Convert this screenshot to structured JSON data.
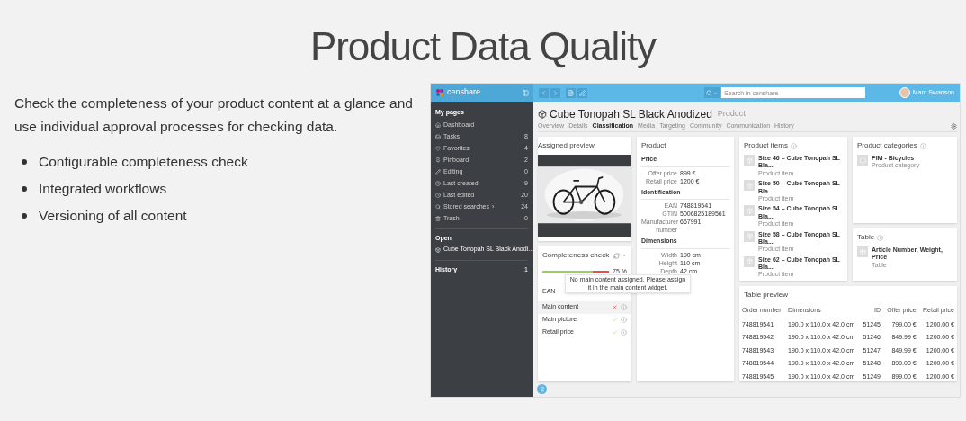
{
  "page": {
    "title": "Product Data Quality",
    "intro": "Check the completeness of your product content at a glance and use individual approval processes for checking data.",
    "bullets": [
      "Configurable completeness check",
      "Integrated workflows",
      "Versioning of all content"
    ]
  },
  "app": {
    "logo": "censhare",
    "search": {
      "placeholder": "Search in censhare"
    },
    "user": "Marc Swanson",
    "sidebar": {
      "heading": "My pages",
      "items": [
        {
          "label": "Dashboard"
        },
        {
          "label": "Tasks",
          "count": "8"
        },
        {
          "label": "Favorites",
          "count": "4"
        },
        {
          "label": "Pinboard",
          "count": "2"
        },
        {
          "label": "Editing",
          "count": "0"
        },
        {
          "label": "Last created",
          "count": "9"
        },
        {
          "label": "Last edited",
          "count": "20"
        },
        {
          "label": "Stored searches",
          "arrow": "›",
          "count": "24"
        },
        {
          "label": "Trash",
          "count": "0"
        }
      ],
      "open_heading": "Open",
      "open_items": [
        {
          "label": "Cube Tonopah SL Black Anodi...",
          "selected": true
        }
      ],
      "history": {
        "label": "History",
        "count": "1"
      }
    },
    "asset": {
      "title": "Cube Tonopah SL Black Anodized",
      "type": "Product",
      "tabs": [
        {
          "label": "Overview",
          "selected": false
        },
        {
          "label": "Details",
          "selected": false
        },
        {
          "label": "Classification",
          "selected": true
        },
        {
          "label": "Media",
          "selected": false
        },
        {
          "label": "Targeting",
          "selected": false
        },
        {
          "label": "Community",
          "selected": false
        },
        {
          "label": "Communication",
          "selected": false
        },
        {
          "label": "History",
          "selected": false
        }
      ]
    },
    "assigned_preview": {
      "title": "Assigned preview"
    },
    "completeness": {
      "title": "Completeness check",
      "level": 0.75,
      "reading": "75 %",
      "column": "EAN",
      "rows": [
        {
          "label": "Main content",
          "ok": false,
          "selected": true
        },
        {
          "label": "Main picture",
          "ok": true,
          "selected": false
        },
        {
          "label": "Retail price",
          "ok": true,
          "selected": false
        }
      ],
      "tooltip": "No main content assigned. Please assign it in the main content widget."
    },
    "product": {
      "title": "Product",
      "sections": [
        {
          "heading": "Price",
          "fields": [
            {
              "label": "Offer price",
              "value": "899 €"
            },
            {
              "label": "Retail price",
              "value": "1200 €"
            }
          ]
        },
        {
          "heading": "Identification",
          "fields": [
            {
              "label": "EAN",
              "value": "748819541"
            },
            {
              "label": "GTIN",
              "value": "5006825189561"
            },
            {
              "label": "Manufacturer number",
              "value": "667991"
            }
          ]
        },
        {
          "heading": "Dimensions",
          "fields": [
            {
              "label": "Width",
              "value": "190 cm"
            },
            {
              "label": "Height",
              "value": "110 cm"
            },
            {
              "label": "Depth",
              "value": "42 cm"
            }
          ]
        }
      ]
    },
    "product_items": {
      "title": "Product items",
      "items": [
        {
          "name": "Size 46 – Cube Tonopah SL Bla...",
          "type": "Product item"
        },
        {
          "name": "Size 50 – Cube Tonopah SL Bla...",
          "type": "Product item"
        },
        {
          "name": "Size 54 – Cube Tonopah SL Bla...",
          "type": "Product item"
        },
        {
          "name": "Size 58 – Cube Tonopah SL Bla...",
          "type": "Product item"
        },
        {
          "name": "Size 62 – Cube Tonopah SL Bla...",
          "type": "Product item"
        }
      ]
    },
    "product_categories": {
      "title": "Product categories",
      "items": [
        {
          "name": "PIM - Bicycles",
          "type": "Product category"
        }
      ]
    },
    "table_widget": {
      "title": "Table",
      "items": [
        {
          "name": "Article Number, Weight, Price",
          "type": "Table"
        }
      ]
    },
    "table_preview": {
      "title": "Table preview",
      "columns": [
        "Order number",
        "Dimensions",
        "ID",
        "Offer price",
        "Retail price"
      ],
      "rows": [
        [
          "748819541",
          "190.0 x 110.0 x 42.0 cm",
          "51245",
          "799.00 €",
          "1200.00 €"
        ],
        [
          "748819542",
          "190.0 x 110.0 x 42.0 cm",
          "51246",
          "849.99 €",
          "1200.00 €"
        ],
        [
          "748819543",
          "190.0 x 110.0 x 42.0 cm",
          "51247",
          "849.99 €",
          "1200.00 €"
        ],
        [
          "748819544",
          "190.0 x 110.0 x 42.0 cm",
          "51248",
          "899.00 €",
          "1200.00 €"
        ],
        [
          "748819545",
          "190.0 x 110.0 x 42.0 cm",
          "51249",
          "899.00 €",
          "1200.00 €"
        ]
      ]
    }
  }
}
